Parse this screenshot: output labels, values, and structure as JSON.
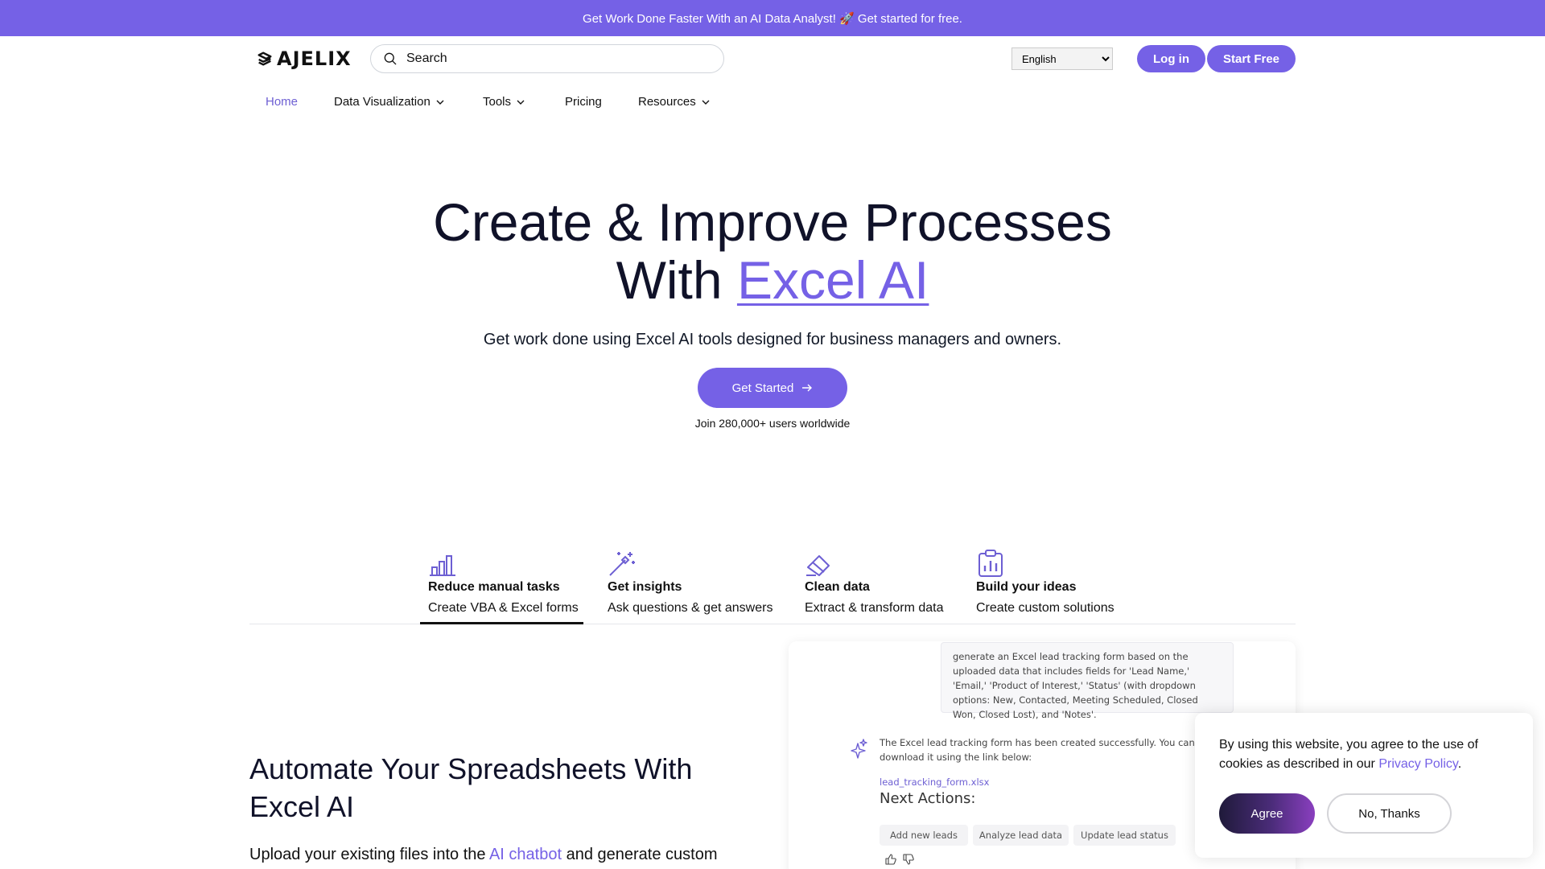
{
  "banner": {
    "text": "Get Work Done Faster With an AI Data Analyst! 🚀 Get started for free."
  },
  "header": {
    "logo": "AJELIX",
    "search_placeholder": "Search",
    "language": "English",
    "language_options": [
      "English"
    ],
    "login_label": "Log in",
    "start_free_label": "Start Free"
  },
  "nav": {
    "items": [
      {
        "label": "Home"
      },
      {
        "label": "Data Visualization"
      },
      {
        "label": "Tools"
      },
      {
        "label": "Pricing"
      },
      {
        "label": "Resources"
      }
    ]
  },
  "hero": {
    "title_line1": "Create & Improve Processes",
    "title_line2_prefix": "With ",
    "title_line2_accent": "Excel AI",
    "subtitle": "Get work done using Excel AI tools designed for business managers and owners.",
    "cta_label": "Get Started",
    "social_proof": "Join 280,000+ users worldwide"
  },
  "features": {
    "tabs": [
      {
        "title": "Reduce manual tasks",
        "subtitle": "Create VBA & Excel forms",
        "icon": "bar-chart-icon"
      },
      {
        "title": "Get insights",
        "subtitle": "Ask questions & get answers",
        "icon": "magic-wand-icon"
      },
      {
        "title": "Clean data",
        "subtitle": "Extract & transform data",
        "icon": "eraser-icon"
      },
      {
        "title": "Build your ideas",
        "subtitle": "Create custom solutions",
        "icon": "clipboard-chart-icon"
      }
    ]
  },
  "automate": {
    "title": "Automate Your Spreadsheets With Excel AI",
    "text_prefix": "Upload your existing files into the ",
    "text_link": "AI chatbot",
    "text_suffix": " and generate custom"
  },
  "chat_preview": {
    "prompt": "generate an Excel lead tracking form based on the uploaded data that includes fields for 'Lead Name,' 'Email,' 'Product of Interest,' 'Status' (with dropdown options: New, Contacted, Meeting Scheduled, Closed Won, Closed Lost), and 'Notes'.",
    "reply": "The Excel lead tracking form has been created successfully. You can download it using the link below:",
    "file_link": "lead_tracking_form.xlsx",
    "next_actions_title": "Next Actions:",
    "actions": [
      "Add new leads",
      "Analyze lead data",
      "Update lead status"
    ]
  },
  "cookie": {
    "text_prefix": "By using this website, you agree to the use of cookies as described in our ",
    "link": "Privacy Policy",
    "text_suffix": ".",
    "agree_label": "Agree",
    "decline_label": "No, Thanks"
  },
  "colors": {
    "accent": "#7561e6",
    "heading": "#101229"
  }
}
